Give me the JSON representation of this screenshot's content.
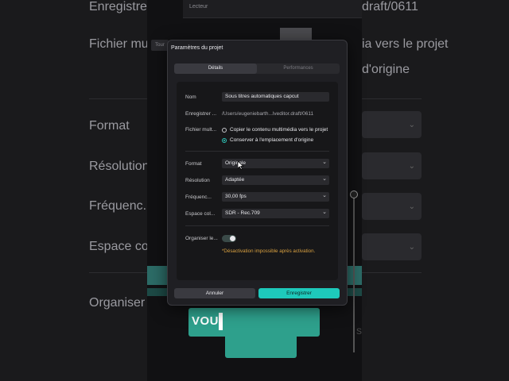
{
  "background": {
    "left_labels": [
      "Enregistrer",
      "Fichier mult",
      "Format",
      "Résolution",
      "Fréquenc...",
      "Espace co",
      "Organiser"
    ],
    "right_labels": [
      "draft/0611",
      "ia vers le projet",
      "d'origine"
    ],
    "player_label": "Lecteur",
    "tour_label": "Tour",
    "caption_text": "VOU"
  },
  "dialog": {
    "title": "Paramètres du projet",
    "tabs": [
      {
        "label": "Détails",
        "active": true
      },
      {
        "label": "Performances",
        "active": false
      }
    ],
    "fields": {
      "name_label": "Nom",
      "name_value": "Sous titres automatiques capcut",
      "save_label": "Enregistrer ...",
      "save_path": "/Users/eugeniebarth...lveditor.draft/0611",
      "media_label": "Fichier mult...",
      "media_option_copy": "Copier le contenu multimédia vers le projet",
      "media_option_keep": "Conserver à l'emplacement d'origine",
      "media_selected": "keep",
      "format_label": "Format",
      "format_value": "Originale",
      "resolution_label": "Résolution",
      "resolution_value": "Adaptée",
      "framerate_label": "Fréquenc...",
      "framerate_value": "30,00 fps",
      "colorspace_label": "Espace col...",
      "colorspace_value": "SDR - Rec.709",
      "organize_label": "Organiser le...",
      "organize_on": true,
      "organize_note": "*Désactivation impossible après activation."
    },
    "buttons": {
      "cancel": "Annuler",
      "save": "Enregistrer"
    }
  },
  "colors": {
    "accent": "#1ec9bb",
    "warning": "#d8a040",
    "caption_bg": "#2ea08c"
  }
}
